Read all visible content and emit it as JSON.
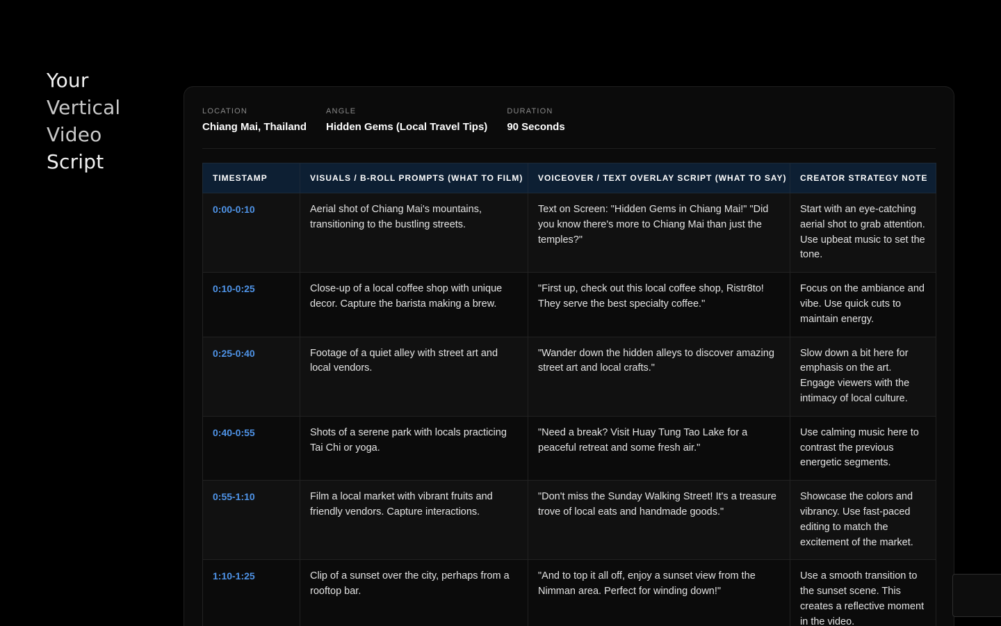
{
  "title_lines": [
    "Your",
    "Vertical",
    "Video",
    "Script"
  ],
  "meta": [
    {
      "label": "LOCATION",
      "value": "Chiang Mai, Thailand"
    },
    {
      "label": "ANGLE",
      "value": "Hidden Gems (Local Travel Tips)"
    },
    {
      "label": "DURATION",
      "value": "90 Seconds"
    }
  ],
  "table": {
    "headers": [
      "TIMESTAMP",
      "VISUALS / B-ROLL PROMPTS (WHAT TO FILM)",
      "VOICEOVER / TEXT OVERLAY SCRIPT (WHAT TO SAY)",
      "CREATOR STRATEGY NOTE"
    ],
    "rows": [
      {
        "timestamp": "0:00-0:10",
        "visuals": "Aerial shot of Chiang Mai's mountains, transitioning to the bustling streets.",
        "voiceover": "Text on Screen: \"Hidden Gems in Chiang Mai!\" \"Did you know there's more to Chiang Mai than just the temples?\"",
        "note": "Start with an eye-catching aerial shot to grab attention. Use upbeat music to set the tone."
      },
      {
        "timestamp": "0:10-0:25",
        "visuals": "Close-up of a local coffee shop with unique decor. Capture the barista making a brew.",
        "voiceover": "\"First up, check out this local coffee shop, Ristr8to! They serve the best specialty coffee.\"",
        "note": "Focus on the ambiance and vibe. Use quick cuts to maintain energy."
      },
      {
        "timestamp": "0:25-0:40",
        "visuals": "Footage of a quiet alley with street art and local vendors.",
        "voiceover": "\"Wander down the hidden alleys to discover amazing street art and local crafts.\"",
        "note": "Slow down a bit here for emphasis on the art. Engage viewers with the intimacy of local culture."
      },
      {
        "timestamp": "0:40-0:55",
        "visuals": "Shots of a serene park with locals practicing Tai Chi or yoga.",
        "voiceover": "\"Need a break? Visit Huay Tung Tao Lake for a peaceful retreat and some fresh air.\"",
        "note": "Use calming music here to contrast the previous energetic segments."
      },
      {
        "timestamp": "0:55-1:10",
        "visuals": "Film a local market with vibrant fruits and friendly vendors. Capture interactions.",
        "voiceover": "\"Don't miss the Sunday Walking Street! It's a treasure trove of local eats and handmade goods.\"",
        "note": "Showcase the colors and vibrancy. Use fast-paced editing to match the excitement of the market."
      },
      {
        "timestamp": "1:10-1:25",
        "visuals": "Clip of a sunset over the city, perhaps from a rooftop bar.",
        "voiceover": "\"And to top it all off, enjoy a sunset view from the Nimman area. Perfect for winding down!\"",
        "note": "Use a smooth transition to the sunset scene. This creates a reflective moment in the video."
      }
    ]
  },
  "colors": {
    "background": "#000000",
    "card": "#0b0b0b",
    "header_bg": "#0d1f33",
    "timestamp": "#4f94e8"
  }
}
